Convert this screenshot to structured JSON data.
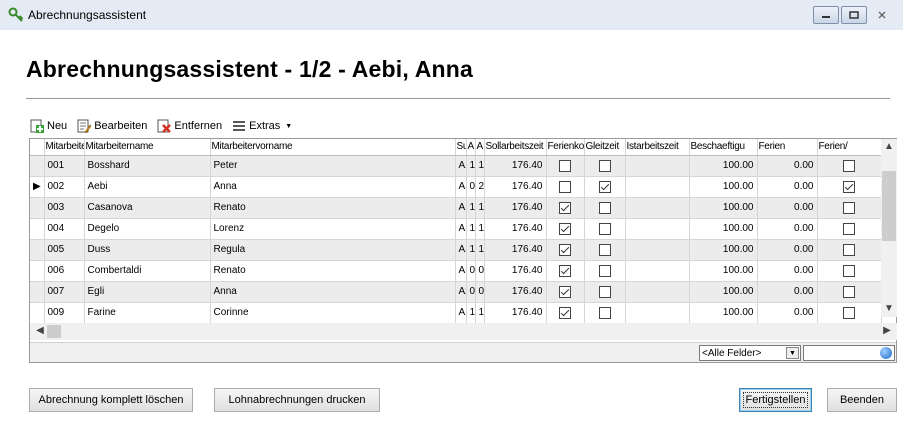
{
  "window": {
    "title": "Abrechnungsassistent",
    "icon": "key-icon",
    "controls": [
      "minimize-icon",
      "maximize-icon",
      "close-icon"
    ]
  },
  "heading": "Abrechnungsassistent - 1/2 - Aebi, Anna",
  "toolbar": {
    "new_label": "Neu",
    "edit_label": "Bearbeiten",
    "remove_label": "Entfernen",
    "extras_label": "Extras",
    "extras_mnemonic": "x"
  },
  "grid": {
    "columns": [
      "Mitarbeitern",
      "Mitarbeitername",
      "Mitarbeitervorname",
      "Su",
      "A",
      "A",
      "Sollarbeitszeit",
      "Ferienko",
      "Gleitzeit",
      "Istarbeitszeit",
      "Beschaeftigu",
      "Ferien",
      "Ferien/"
    ],
    "current_row_marker": "▶",
    "rows": [
      {
        "nr": "001",
        "name": "Bosshard",
        "vorname": "Peter",
        "su": "A1",
        "a1": "1",
        "a2": "1",
        "soll": "176.40",
        "ferienko": false,
        "gleitzeit": false,
        "ist": "",
        "besch": "100.00",
        "ferien": "0.00",
        "ferien2": false,
        "current": false
      },
      {
        "nr": "002",
        "name": "Aebi",
        "vorname": "Anna",
        "su": "A1",
        "a1": "0",
        "a2": "2",
        "soll": "176.40",
        "ferienko": false,
        "gleitzeit": true,
        "ist": "",
        "besch": "100.00",
        "ferien": "0.00",
        "ferien2": true,
        "current": true
      },
      {
        "nr": "003",
        "name": "Casanova",
        "vorname": "Renato",
        "su": "A1",
        "a1": "1",
        "a2": "1",
        "soll": "176.40",
        "ferienko": true,
        "gleitzeit": false,
        "ist": "",
        "besch": "100.00",
        "ferien": "0.00",
        "ferien2": false,
        "current": false
      },
      {
        "nr": "004",
        "name": "Degelo",
        "vorname": "Lorenz",
        "su": "A1",
        "a1": "1",
        "a2": "1",
        "soll": "176.40",
        "ferienko": true,
        "gleitzeit": false,
        "ist": "",
        "besch": "100.00",
        "ferien": "0.00",
        "ferien2": false,
        "current": false
      },
      {
        "nr": "005",
        "name": "Duss",
        "vorname": "Regula",
        "su": "A1",
        "a1": "1",
        "a2": "1",
        "soll": "176.40",
        "ferienko": true,
        "gleitzeit": false,
        "ist": "",
        "besch": "100.00",
        "ferien": "0.00",
        "ferien2": false,
        "current": false
      },
      {
        "nr": "006",
        "name": "Combertaldi",
        "vorname": "Renato",
        "su": "A1",
        "a1": "0",
        "a2": "0",
        "soll": "176.40",
        "ferienko": true,
        "gleitzeit": false,
        "ist": "",
        "besch": "100.00",
        "ferien": "0.00",
        "ferien2": false,
        "current": false
      },
      {
        "nr": "007",
        "name": "Egli",
        "vorname": "Anna",
        "su": "A2",
        "a1": "0",
        "a2": "0",
        "soll": "176.40",
        "ferienko": true,
        "gleitzeit": false,
        "ist": "",
        "besch": "100.00",
        "ferien": "0.00",
        "ferien2": false,
        "current": false
      },
      {
        "nr": "009",
        "name": "Farine",
        "vorname": "Corinne",
        "su": "A1",
        "a1": "1",
        "a2": "1",
        "soll": "176.40",
        "ferienko": true,
        "gleitzeit": false,
        "ist": "",
        "besch": "100.00",
        "ferien": "0.00",
        "ferien2": false,
        "current": false
      }
    ],
    "filter_field": "<Alle Felder>",
    "filter_value": ""
  },
  "buttons": {
    "delete_all": "Abrechnung komplett löschen",
    "print": "Lohnabrechnungen drucken",
    "finish": "Fertigstellen",
    "close": "Beenden"
  }
}
